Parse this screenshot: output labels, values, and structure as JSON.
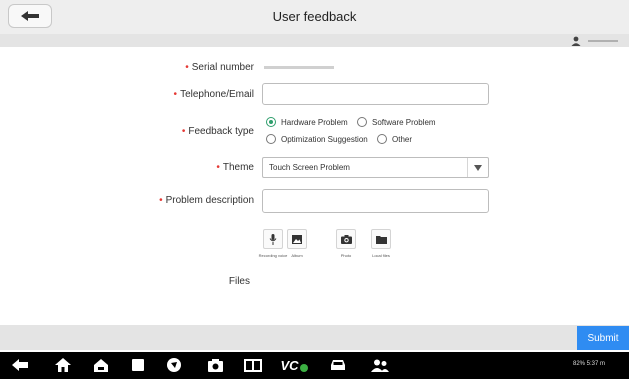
{
  "header": {
    "title": "User feedback",
    "back_icon": "arrow-left-icon"
  },
  "user": {
    "icon": "person-icon"
  },
  "form": {
    "serial_label": "Serial number",
    "phone_label": "Telephone/Email",
    "feedback_type_label": "Feedback type",
    "theme_label": "Theme",
    "problem_label": "Problem description",
    "files_label": "Files",
    "phone_value": "",
    "problem_value": "",
    "feedback_options": [
      {
        "label": "Hardware Problem",
        "checked": true
      },
      {
        "label": "Software Problem",
        "checked": false
      },
      {
        "label": "Optimization Suggestion",
        "checked": false
      },
      {
        "label": "Other",
        "checked": false
      }
    ],
    "theme_selected": "Touch Screen Problem",
    "attachments": [
      {
        "label": "Recording voice",
        "icon": "microphone-icon"
      },
      {
        "label": "Album",
        "icon": "image-icon"
      },
      {
        "label": "Photo",
        "icon": "camera-icon"
      },
      {
        "label": "Local files",
        "icon": "folder-icon"
      }
    ]
  },
  "footer": {
    "submit_label": "Submit"
  },
  "navbar": {
    "icons": [
      "back-icon",
      "home-icon",
      "house-icon",
      "recent-apps-icon",
      "browser-icon",
      "camera-icon",
      "screen-mirror-icon",
      "vci-icon",
      "car-icon",
      "user-group-icon"
    ],
    "vci_text": "VC",
    "status_text": "82% 5:37 m"
  },
  "colors": {
    "accent": "#2f8cf2",
    "radio": "#2e9e6c",
    "required": "#e53935"
  }
}
